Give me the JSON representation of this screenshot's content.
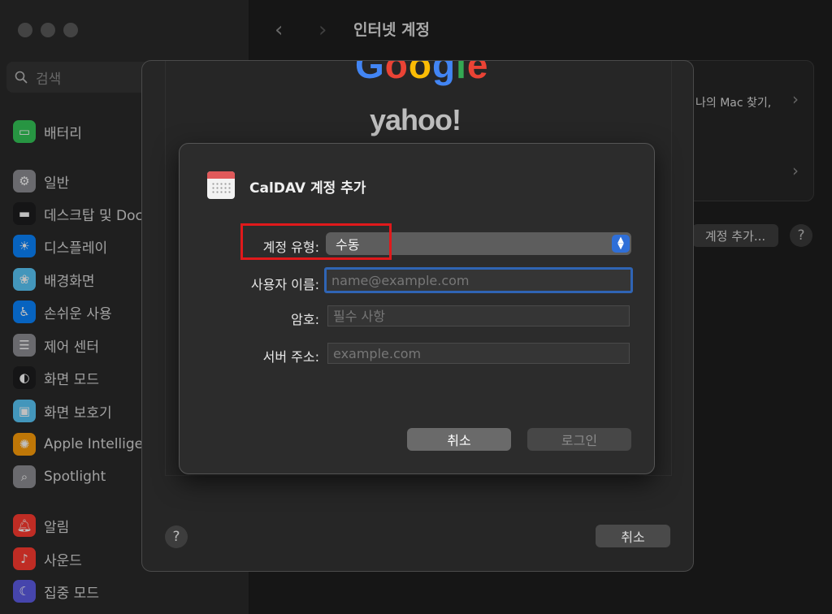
{
  "window": {
    "title": "인터넷 계정"
  },
  "sidebar": {
    "search_placeholder": "검색",
    "items": [
      {
        "label": "배터리",
        "icon": "battery-icon",
        "color": "#34c759"
      },
      {
        "label": "일반",
        "icon": "gear-icon",
        "color": "#8e8e93"
      },
      {
        "label": "데스크탑 및 Dock",
        "icon": "dock-icon",
        "color": "#1c1c1e"
      },
      {
        "label": "디스플레이",
        "icon": "display-icon",
        "color": "#0a84ff"
      },
      {
        "label": "배경화면",
        "icon": "wallpaper-icon",
        "color": "#5ac8fa"
      },
      {
        "label": "손쉬운 사용",
        "icon": "accessibility-icon",
        "color": "#0a84ff"
      },
      {
        "label": "제어 센터",
        "icon": "control-center-icon",
        "color": "#8e8e93"
      },
      {
        "label": "화면 모드",
        "icon": "appearance-icon",
        "color": "#1c1c1e"
      },
      {
        "label": "화면 보호기",
        "icon": "screensaver-icon",
        "color": "#5ac8fa"
      },
      {
        "label": "Apple Intelligence",
        "icon": "apple-intelligence-icon",
        "color": "#ff9f0a"
      },
      {
        "label": "Spotlight",
        "icon": "spotlight-icon",
        "color": "#8e8e93"
      },
      {
        "label": "알림",
        "icon": "bell-icon",
        "color": "#ff3b30"
      },
      {
        "label": "사운드",
        "icon": "speaker-icon",
        "color": "#ff3b30"
      },
      {
        "label": "집중 모드",
        "icon": "moon-icon",
        "color": "#5e5ce6"
      }
    ]
  },
  "main": {
    "right_text": "나의 Mac 찾기,",
    "add_account_label": "계정 추가...",
    "help": "?"
  },
  "sheet": {
    "google_logo": "Google",
    "yahoo_logo": "yahoo!",
    "help": "?",
    "cancel_label": "취소"
  },
  "dialog": {
    "title": "CalDAV 계정 추가",
    "account_type_label": "계정 유형:",
    "account_type_value": "수동",
    "username_label": "사용자 이름:",
    "username_placeholder": "name@example.com",
    "password_label": "암호:",
    "password_placeholder": "필수 사항",
    "server_label": "서버 주소:",
    "server_placeholder": "example.com",
    "cancel_label": "취소",
    "login_label": "로그인"
  },
  "colors": {
    "highlight": "#e0191b",
    "accent": "#2f6fd8"
  }
}
